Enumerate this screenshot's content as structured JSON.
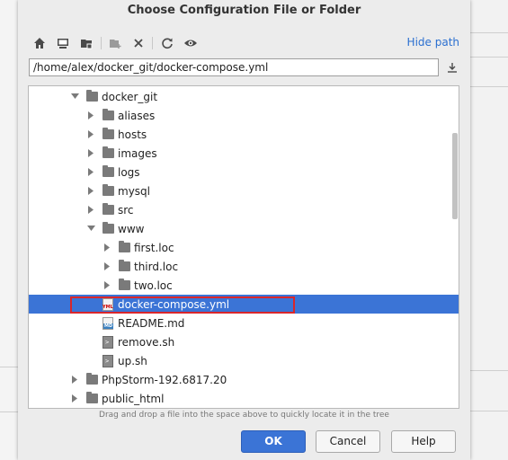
{
  "dialog": {
    "title": "Choose Configuration File or Folder",
    "hide_path_label": "Hide path",
    "path_value": "/home/alex/docker_git/docker-compose.yml",
    "hint": "Drag and drop a file into the space above to quickly locate it in the tree",
    "buttons": {
      "ok": "OK",
      "cancel": "Cancel",
      "help": "Help"
    }
  },
  "toolbar": [
    {
      "name": "home-icon",
      "icon": "home"
    },
    {
      "name": "desktop-icon",
      "icon": "desktop"
    },
    {
      "name": "project-folder-icon",
      "icon": "project-folder"
    },
    {
      "name": "new-folder-icon",
      "icon": "new-folder"
    },
    {
      "name": "delete-icon",
      "icon": "close"
    },
    {
      "name": "refresh-icon",
      "icon": "refresh"
    },
    {
      "name": "show-hidden-icon",
      "icon": "eye"
    }
  ],
  "tree": [
    {
      "label": "docker_git",
      "type": "folder",
      "state": "expanded",
      "depth": 0
    },
    {
      "label": "aliases",
      "type": "folder",
      "state": "collapsed",
      "depth": 1
    },
    {
      "label": "hosts",
      "type": "folder",
      "state": "collapsed",
      "depth": 1
    },
    {
      "label": "images",
      "type": "folder",
      "state": "collapsed",
      "depth": 1
    },
    {
      "label": "logs",
      "type": "folder",
      "state": "collapsed",
      "depth": 1
    },
    {
      "label": "mysql",
      "type": "folder",
      "state": "collapsed",
      "depth": 1
    },
    {
      "label": "src",
      "type": "folder",
      "state": "collapsed",
      "depth": 1
    },
    {
      "label": "www",
      "type": "folder",
      "state": "expanded",
      "depth": 1
    },
    {
      "label": "first.loc",
      "type": "folder",
      "state": "collapsed",
      "depth": 2
    },
    {
      "label": "third.loc",
      "type": "folder",
      "state": "collapsed",
      "depth": 2
    },
    {
      "label": "two.loc",
      "type": "folder",
      "state": "collapsed",
      "depth": 2
    },
    {
      "label": "docker-compose.yml",
      "type": "yml",
      "state": "leaf",
      "depth": 1,
      "selected": true
    },
    {
      "label": "README.md",
      "type": "md",
      "state": "leaf",
      "depth": 1
    },
    {
      "label": "remove.sh",
      "type": "sh",
      "state": "leaf",
      "depth": 1
    },
    {
      "label": "up.sh",
      "type": "sh",
      "state": "leaf",
      "depth": 1
    },
    {
      "label": "PhpStorm-192.6817.20",
      "type": "folder",
      "state": "collapsed",
      "depth": 0
    },
    {
      "label": "public_html",
      "type": "folder",
      "state": "collapsed",
      "depth": 0
    }
  ],
  "colors": {
    "selection": "#3b74d6",
    "link": "#2a6fd0",
    "highlight_border": "#d9262b"
  }
}
